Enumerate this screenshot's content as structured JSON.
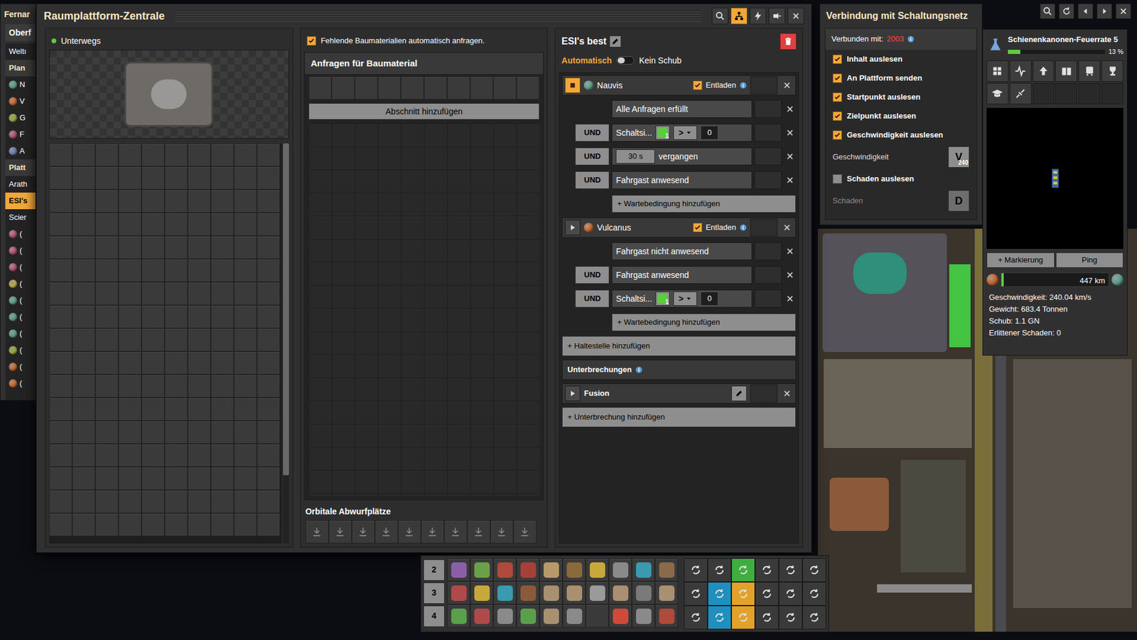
{
  "left_window": {
    "title": "Fernar",
    "tab": "Oberf",
    "items": [
      {
        "kind": "row",
        "text": "Weltı",
        "selected": false
      },
      {
        "kind": "header",
        "text": "Plan",
        "selected": false
      },
      {
        "kind": "planet",
        "text": "N",
        "color": "#5a9e8a",
        "selected": false
      },
      {
        "kind": "planet",
        "text": "V",
        "color": "#c8662a",
        "selected": false
      },
      {
        "kind": "planet",
        "text": "G",
        "color": "#9aa83a",
        "selected": false
      },
      {
        "kind": "planet",
        "text": "F",
        "color": "#b0506e",
        "selected": false
      },
      {
        "kind": "planet",
        "text": "A",
        "color": "#6a7ea8",
        "selected": false
      },
      {
        "kind": "header",
        "text": "Platt",
        "selected": false
      },
      {
        "kind": "row",
        "text": "Arath",
        "selected": false
      },
      {
        "kind": "row",
        "text": "ESI's",
        "selected": true
      },
      {
        "kind": "row",
        "text": "Scier",
        "selected": false
      },
      {
        "kind": "planet",
        "text": "(",
        "color": "#b0506e",
        "selected": false
      },
      {
        "kind": "planet",
        "text": "(",
        "color": "#b0506e",
        "selected": false
      },
      {
        "kind": "planet",
        "text": "(",
        "color": "#b0506e",
        "selected": false
      },
      {
        "kind": "planet",
        "text": "(",
        "color": "#b8a848",
        "selected": false
      },
      {
        "kind": "planet",
        "text": "(",
        "color": "#5a9e8a",
        "selected": false
      },
      {
        "kind": "planet",
        "text": "(",
        "color": "#5a9e8a",
        "selected": false
      },
      {
        "kind": "planet",
        "text": "(",
        "color": "#5a9e8a",
        "selected": false
      },
      {
        "kind": "planet",
        "text": "(",
        "color": "#9aa83a",
        "selected": false
      },
      {
        "kind": "planet",
        "text": "(",
        "color": "#c8662a",
        "selected": false
      },
      {
        "kind": "planet",
        "text": "(",
        "color": "#c8662a",
        "selected": false
      }
    ]
  },
  "main_window": {
    "title": "Raumplattform-Zentrale",
    "title_buttons": [
      {
        "selected": false
      },
      {
        "selected": true
      },
      {
        "selected": false
      },
      {
        "selected": false
      },
      {
        "selected": false
      }
    ],
    "platform": {
      "status": "Unterwegs",
      "status_color": "#5ecb3f"
    },
    "requests": {
      "auto_request": {
        "label": "Fehlende Baumaterialien automatisch anfragen.",
        "checked": true
      },
      "header": "Anfragen für Baumaterial",
      "add_section": "Abschnitt hinzufügen",
      "drop_slots_label": "Orbitale Abwurfplätze"
    },
    "schedule": {
      "name": "ESI's best",
      "mode": {
        "left": "Automatisch",
        "right": "Kein Schub",
        "left_active": true
      },
      "stops": [
        {
          "name": "Nauvis",
          "color": "#5a9e8a",
          "active": true,
          "unload": {
            "label": "Entladen",
            "checked": true
          },
          "conditions": [
            {
              "kind": "text",
              "connector": null,
              "text": "Alle Anfragen erfüllt"
            },
            {
              "kind": "circuit",
              "connector": "UND",
              "label": "Schaltsi...",
              "signal_color": "#5ecb3f",
              "signal_count": "1",
              "operator": ">",
              "value": "0"
            },
            {
              "kind": "time",
              "connector": "UND",
              "value": "30 s",
              "text": "vergangen"
            },
            {
              "kind": "text",
              "connector": "UND",
              "text": "Fahrgast anwesend"
            }
          ],
          "add_condition": "+ Wartebedingung hinzufügen"
        },
        {
          "name": "Vulcanus",
          "color": "#c8662a",
          "active": false,
          "unload": {
            "label": "Entladen",
            "checked": true
          },
          "conditions": [
            {
              "kind": "text",
              "connector": null,
              "text": "Fahrgast nicht anwesend"
            },
            {
              "kind": "text",
              "connector": "UND",
              "text": "Fahrgast anwesend"
            },
            {
              "kind": "circuit",
              "connector": "UND",
              "label": "Schaltsi...",
              "signal_color": "#5ecb3f",
              "signal_count": "1",
              "operator": ">",
              "value": "0"
            }
          ],
          "add_condition": "+ Wartebedingung hinzufügen"
        }
      ],
      "add_stop": "+ Haltestelle hinzufügen",
      "interrupts_label": "Unterbrechungen",
      "interrupts": [
        {
          "name": "Fusion",
          "active": false
        }
      ],
      "add_interrupt": "+ Unterbrechung hinzufügen"
    }
  },
  "circuit_window": {
    "title": "Verbindung mit Schaltungsnetz",
    "connected_label": "Verbunden mit:",
    "connected_id": "2003",
    "options": [
      {
        "kind": "checkbox",
        "label": "Inhalt auslesen",
        "checked": true
      },
      {
        "kind": "checkbox",
        "label": "An Plattform senden",
        "checked": true
      },
      {
        "kind": "checkbox",
        "label": "Startpunkt auslesen",
        "checked": true
      },
      {
        "kind": "checkbox",
        "label": "Zielpunkt auslesen",
        "checked": true
      },
      {
        "kind": "checkbox",
        "label": "Geschwindigkeit auslesen",
        "checked": true
      },
      {
        "kind": "signal",
        "label": "Geschwindigkeit",
        "signal": "V",
        "count": "240",
        "disabled": false
      },
      {
        "kind": "checkbox",
        "label": "Schaden auslesen",
        "checked": false
      },
      {
        "kind": "signal",
        "label": "Schaden",
        "signal": "D",
        "disabled": true
      }
    ]
  },
  "side_panel": {
    "research": {
      "label": "Schienenkanonen-Feuerrate 5",
      "level": 0.13,
      "reading": "13 %"
    },
    "buttons": [
      "+ Markierung",
      "Ping"
    ],
    "travel": {
      "from_color": "#c8662a",
      "to_color": "#5a9e8a",
      "level": 0.02,
      "reading": "447 km"
    },
    "stats": [
      "Geschwindigkeit: 240.04 km/s",
      "Gewicht: 683.4 Tonnen",
      "Schub: 1.1 GN",
      "Erlittener Schaden: 0"
    ]
  },
  "quickbar": {
    "rows": [
      {
        "label": "2",
        "slots": [
          {
            "color": "#8a5fa8"
          },
          {
            "color": "#6aa04a"
          },
          {
            "color": "#b04a3a"
          },
          {
            "color": "#a8403a"
          },
          {
            "color": "#b89a6a"
          },
          {
            "color": "#8a6a3a"
          },
          {
            "color": "#c8a83a"
          },
          {
            "color": "#8a8a8a"
          },
          {
            "color": "#3a9ab0"
          },
          {
            "color": "#8a6a4a"
          }
        ]
      },
      {
        "label": "3",
        "slots": [
          {
            "color": "#b04a4a"
          },
          {
            "color": "#c8a83a"
          },
          {
            "color": "#3a9ab0"
          },
          {
            "color": "#8a5a3a"
          },
          {
            "color": "#a89070"
          },
          {
            "color": "#a89070"
          },
          {
            "color": "#9a9a9a"
          },
          {
            "color": "#a89070"
          },
          {
            "color": "#7a7a7a"
          },
          {
            "color": "#a89070"
          }
        ]
      },
      {
        "label": "4",
        "slots": [
          {
            "color": "#5aa04a"
          },
          {
            "color": "#b04a4a"
          },
          {
            "color": "#8a8a8a"
          },
          {
            "color": "#5aa04a"
          },
          {
            "color": "#a89070"
          },
          {
            "color": "#8a8a8a"
          },
          {
            "color": null
          },
          {
            "color": "#d04a3a"
          },
          {
            "color": "#8a8a8a"
          },
          {
            "color": "#b04a3a"
          }
        ]
      }
    ],
    "tools": [
      {
        "highlight": null
      },
      {
        "highlight": null
      },
      {
        "highlight": "#3fae3f"
      },
      {
        "highlight": null
      },
      {
        "highlight": null
      },
      {
        "highlight": null
      },
      {
        "highlight": null
      },
      {
        "highlight": "#1f8fc0"
      },
      {
        "highlight": "#e2a22a"
      },
      {
        "highlight": null
      },
      {
        "highlight": null
      },
      {
        "highlight": null
      },
      {
        "highlight": null
      },
      {
        "highlight": "#1f8fc0"
      },
      {
        "highlight": "#e2a22a"
      },
      {
        "highlight": null
      },
      {
        "highlight": null
      },
      {
        "highlight": null
      }
    ]
  }
}
